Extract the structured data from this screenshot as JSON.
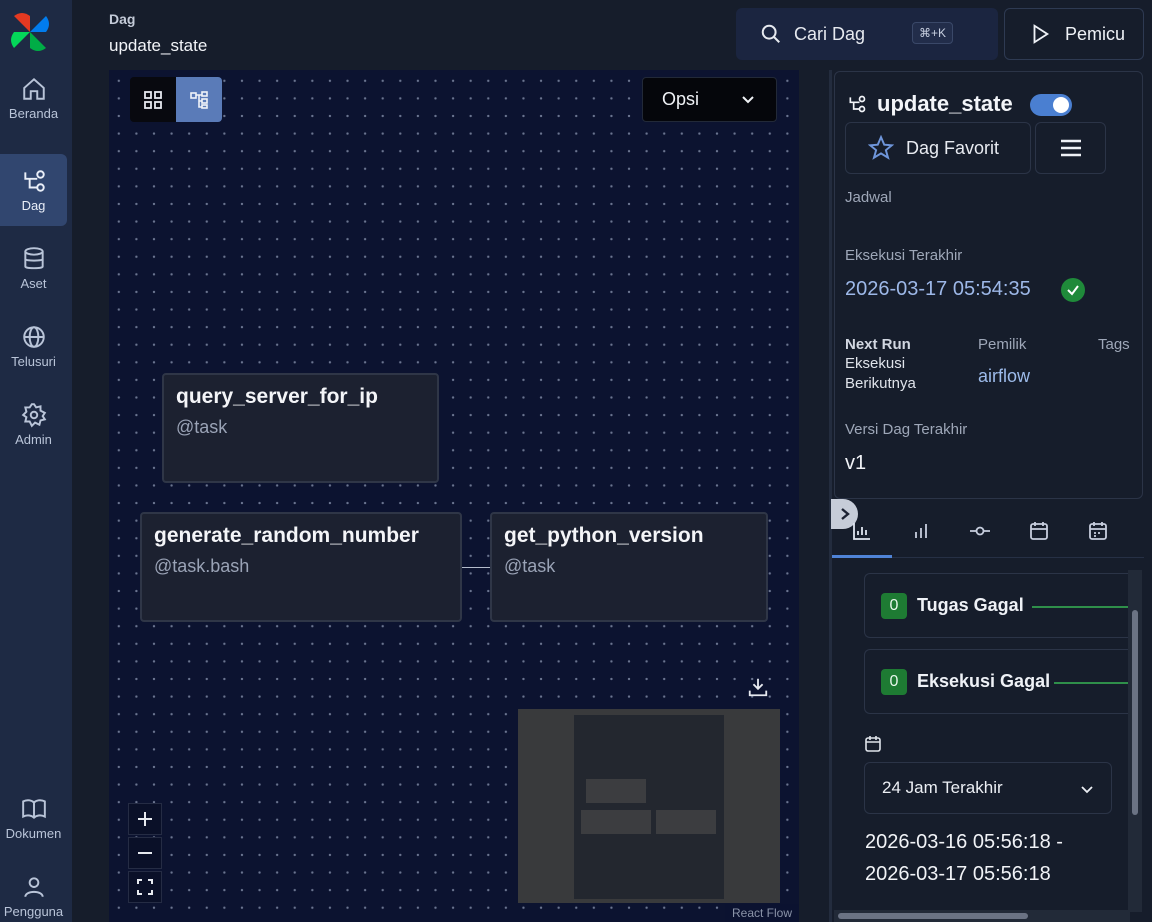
{
  "sidebar": {
    "logo": "airflow-logo",
    "items": [
      {
        "label": "Beranda",
        "icon": "home-icon"
      },
      {
        "label": "Dag",
        "icon": "dag-icon",
        "active": true
      },
      {
        "label": "Aset",
        "icon": "database-icon"
      },
      {
        "label": "Telusuri",
        "icon": "globe-icon"
      },
      {
        "label": "Admin",
        "icon": "gear-icon"
      }
    ],
    "bottom_items": [
      {
        "label": "Dokumen",
        "icon": "book-icon"
      },
      {
        "label": "Pengguna",
        "icon": "user-icon"
      }
    ]
  },
  "header": {
    "breadcrumb_label": "Dag",
    "breadcrumb_title": "update_state",
    "search_label": "Cari Dag",
    "search_shortcut": "⌘+K",
    "trigger_label": "Pemicu"
  },
  "graph": {
    "options_label": "Opsi",
    "nodes": [
      {
        "title": "query_server_for_ip",
        "subtitle": "@task"
      },
      {
        "title": "generate_random_number",
        "subtitle": "@task.bash"
      },
      {
        "title": "get_python_version",
        "subtitle": "@task"
      }
    ],
    "attribution": "React Flow",
    "zoom_in": "+",
    "zoom_out": "−"
  },
  "details": {
    "dag_name": "update_state",
    "active": true,
    "favorite_label": "Dag Favorit",
    "schedule_label": "Jadwal",
    "last_run_label": "Eksekusi Terakhir",
    "last_run_value": "2026-03-17 05:54:35",
    "last_run_status": "success",
    "next_run_label": "Next Run",
    "next_run_value_line1": "Eksekusi",
    "next_run_value_line2": "Berikutnya",
    "owner_label": "Pemilik",
    "owner_value": "airflow",
    "tags_label": "Tags",
    "latest_version_label": "Versi Dag Terakhir",
    "latest_version_value": "v1"
  },
  "tabs": [
    "chart-icon",
    "bar-icon",
    "commit-icon",
    "calendar-icon",
    "calendar-grid-icon"
  ],
  "stats": [
    {
      "count": "0",
      "label": "Tugas Gagal"
    },
    {
      "count": "0",
      "label": "Eksekusi Gagal"
    }
  ],
  "time_range": {
    "label": "24 Jam Terakhir",
    "from": "2026-03-16 05:56:18 -",
    "to": "2026-03-17 05:56:18"
  },
  "colors": {
    "sidebar_bg": "#1e2a44",
    "canvas_bg": "#0c1330",
    "accent": "#4f83d6",
    "success": "#1f8a3a"
  }
}
